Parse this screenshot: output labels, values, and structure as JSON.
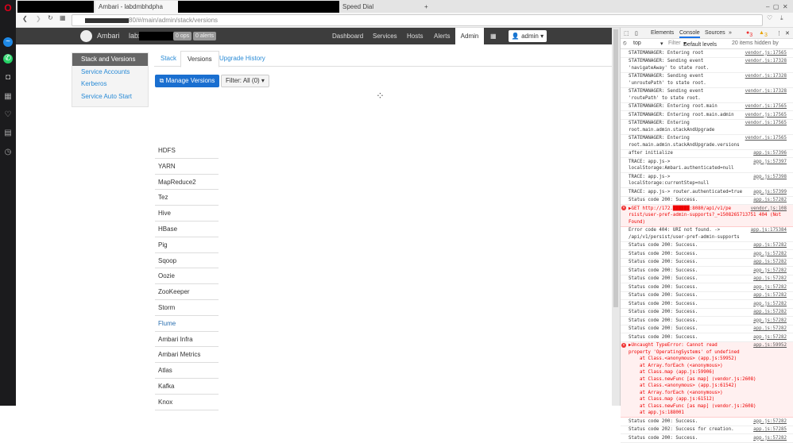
{
  "browser": {
    "tabs": [
      {
        "label": "Ambari - labdmbhdpha"
      },
      {
        "label": "Speed Dial"
      }
    ],
    "url": "80/#/main/admin/stack/versions"
  },
  "navbar": {
    "brand": "Ambari",
    "cluster": "labx",
    "ops_badge": "0 ops",
    "alerts_badge": "0 alerts",
    "items": [
      "Dashboard",
      "Services",
      "Hosts",
      "Alerts",
      "Admin"
    ],
    "user": "admin"
  },
  "sidebar": {
    "items": [
      "Stack and Versions",
      "Service Accounts",
      "Kerberos",
      "Service Auto Start"
    ]
  },
  "content": {
    "tabs": [
      "Stack",
      "Versions",
      "Upgrade History"
    ],
    "manage_button": "Manage Versions",
    "filter": "Filter: All (0)",
    "services": [
      "HDFS",
      "YARN",
      "MapReduce2",
      "Tez",
      "Hive",
      "HBase",
      "Pig",
      "Sqoop",
      "Oozie",
      "ZooKeeper",
      "Storm",
      "Flume",
      "Ambari Infra",
      "Ambari Metrics",
      "Atlas",
      "Kafka",
      "Knox"
    ]
  },
  "devtools": {
    "tabs": [
      "Elements",
      "Console",
      "Sources"
    ],
    "errors": "3",
    "warnings": "3",
    "context": "top",
    "filter_placeholder": "Filter",
    "levels": "Default levels",
    "hidden": "20 items hidden by",
    "logs": [
      {
        "text": "STATEMANAGER: Entering root",
        "src": "vendor.js:17565",
        "type": "log"
      },
      {
        "text": "STATEMANAGER: Sending event\n'navigateAway' to state root.",
        "src": "vendor.js:17328",
        "type": "log"
      },
      {
        "text": "STATEMANAGER: Sending event\n'unroutePath' to state root.",
        "src": "vendor.js:17328",
        "type": "log"
      },
      {
        "text": "STATEMANAGER: Sending event\n'routePath' to state root.",
        "src": "vendor.js:17328",
        "type": "log"
      },
      {
        "text": "STATEMANAGER: Entering root.main",
        "src": "vendor.js:17565",
        "type": "log"
      },
      {
        "text": "STATEMANAGER: Entering root.main.admin",
        "src": "vendor.js:17565",
        "type": "log"
      },
      {
        "text": "STATEMANAGER: Entering\nroot.main.admin.stackAndUpgrade",
        "src": "vendor.js:17565",
        "type": "log"
      },
      {
        "text": "STATEMANAGER: Entering\nroot.main.admin.stackAndUpgrade.versions",
        "src": "vendor.js:17565",
        "type": "log"
      },
      {
        "text": "after initialize",
        "src": "app.js:57396",
        "type": "log"
      },
      {
        "text": "TRACE: app.js->\nlocalStorage:Ambari.authenticated=null",
        "src": "app.js:57397",
        "type": "log"
      },
      {
        "text": "TRACE: app.js->\nlocalStorage:currentStep=null",
        "src": "app.js:57398",
        "type": "log"
      },
      {
        "text": "TRACE: app.js-> router.authenticated=true",
        "src": "app.js:57399",
        "type": "log"
      },
      {
        "text": "Status code 200: Success.",
        "src": "app.js:57282",
        "type": "log"
      },
      {
        "text": "▶GET http://172.██████:8080/api/v1/pe\nrsist/user-pref-admin-supports?_=1508265713751 404 (Not\nFound)",
        "src": "vendor.js:108",
        "type": "err"
      },
      {
        "text": "Error code 404: URI not found. ->\n/api/v1/persist/user-pref-admin-supports",
        "src": "app.js:175384",
        "type": "log"
      },
      {
        "text": "Status code 200: Success.",
        "src": "app.js:57282",
        "type": "log"
      },
      {
        "text": "Status code 200: Success.",
        "src": "app.js:57282",
        "type": "log"
      },
      {
        "text": "Status code 200: Success.",
        "src": "app.js:57282",
        "type": "log"
      },
      {
        "text": "Status code 200: Success.",
        "src": "app.js:57282",
        "type": "log"
      },
      {
        "text": "Status code 200: Success.",
        "src": "app.js:57282",
        "type": "log"
      },
      {
        "text": "Status code 200: Success.",
        "src": "app.js:57282",
        "type": "log"
      },
      {
        "text": "Status code 200: Success.",
        "src": "app.js:57282",
        "type": "log"
      },
      {
        "text": "Status code 200: Success.",
        "src": "app.js:57282",
        "type": "log"
      },
      {
        "text": "Status code 200: Success.",
        "src": "app.js:57282",
        "type": "log"
      },
      {
        "text": "Status code 200: Success.",
        "src": "app.js:57282",
        "type": "log"
      },
      {
        "text": "Status code 200: Success.",
        "src": "app.js:57282",
        "type": "log"
      },
      {
        "text": "Status code 200: Success.",
        "src": "app.js:57282",
        "type": "log"
      },
      {
        "text": "▶Uncaught TypeError: Cannot read\nproperty 'OperatingSystems' of undefined\n    at Class.<anonymous> (app.js:59952)\n    at Array.forEach (<anonymous>)\n    at Class.map (app.js:59906)\n    at Class.newFunc [as map] (vendor.js:2608)\n    at Class.<anonymous> (app.js:61542)\n    at Array.forEach (<anonymous>)\n    at Class.map (app.js:61512)\n    at Class.newFunc [as map] (vendor.js:2608)\n    at app.js:188001",
        "src": "app.js:59952",
        "type": "err"
      },
      {
        "text": "Status code 200: Success.",
        "src": "app.js:57282",
        "type": "log"
      },
      {
        "text": "Status code 202: Success for creation.",
        "src": "app.js:57285",
        "type": "log"
      },
      {
        "text": "Status code 200: Success.",
        "src": "app.js:57282",
        "type": "log"
      }
    ]
  }
}
